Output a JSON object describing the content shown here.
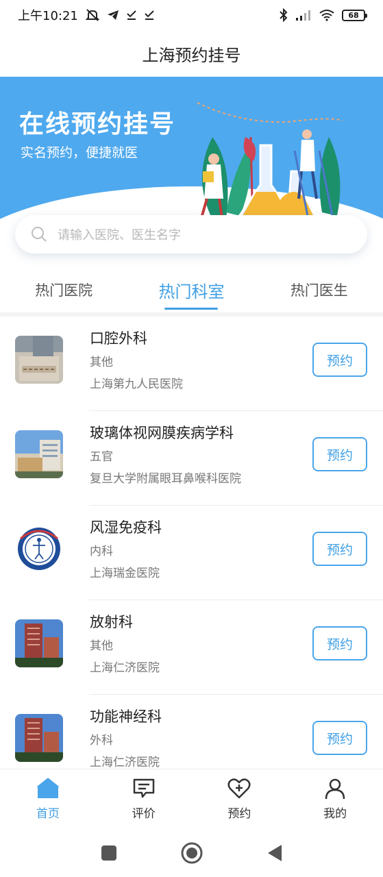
{
  "status_bar": {
    "time": "上午10:21",
    "battery": "68"
  },
  "header": {
    "title": "上海预约挂号"
  },
  "banner": {
    "title": "在线预约挂号",
    "subtitle": "实名预约，便捷就医"
  },
  "search": {
    "placeholder": "请输入医院、医生名字"
  },
  "tabs": [
    {
      "label": "热门医院",
      "active": false
    },
    {
      "label": "热门科室",
      "active": true
    },
    {
      "label": "热门医生",
      "active": false
    }
  ],
  "departments": [
    {
      "name": "口腔外科",
      "category": "其他",
      "hospital": "上海第九人民医院",
      "button": "预约"
    },
    {
      "name": "玻璃体视网膜疾病学科",
      "category": "五官",
      "hospital": "复旦大学附属眼耳鼻喉科医院",
      "button": "预约"
    },
    {
      "name": "风湿免疫科",
      "category": "内科",
      "hospital": "上海瑞金医院",
      "button": "预约"
    },
    {
      "name": "放射科",
      "category": "其他",
      "hospital": "上海仁济医院",
      "button": "预约"
    },
    {
      "name": "功能神经科",
      "category": "外科",
      "hospital": "上海仁济医院",
      "button": "预约"
    }
  ],
  "bottom_nav": [
    {
      "label": "首页",
      "icon": "home-icon",
      "active": true
    },
    {
      "label": "评价",
      "icon": "comment-icon",
      "active": false
    },
    {
      "label": "预约",
      "icon": "heart-plus-icon",
      "active": false
    },
    {
      "label": "我的",
      "icon": "user-icon",
      "active": false
    }
  ],
  "colors": {
    "accent": "#3f9fe6",
    "banner": "#4fa9ee"
  }
}
